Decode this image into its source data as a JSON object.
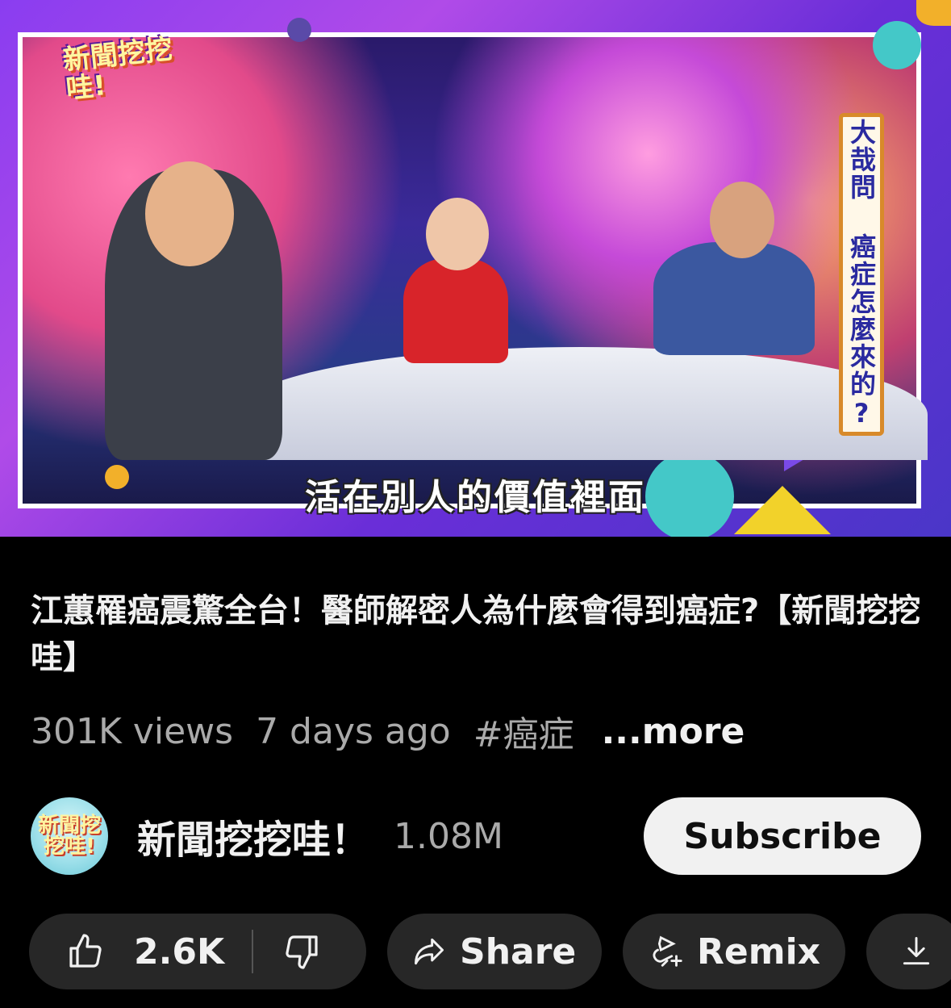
{
  "video": {
    "logo_text": "新聞挖挖哇!",
    "side_banner": "大哉問 癌症怎麼來的?",
    "subtitle": "活在別人的價值裡面"
  },
  "title": "江蕙罹癌震驚全台！醫師解密人為什麼會得到癌症?【新聞挖挖哇】",
  "meta": {
    "views": "301K views",
    "age": "7 days ago",
    "hashtag": "#癌症",
    "more": "...more"
  },
  "channel": {
    "avatar_text": "新聞挖挖哇!",
    "name": "新聞挖挖哇！",
    "subscribers": "1.08M",
    "subscribe_label": "Subscribe"
  },
  "actions": {
    "like_count": "2.6K",
    "share_label": "Share",
    "remix_label": "Remix"
  },
  "colors": {
    "background": "#000000",
    "pill": "#272727",
    "subscribe_bg": "#f1f1f1",
    "secondary_text": "#aaaaaa"
  },
  "icons": [
    "thumbs-up-icon",
    "thumbs-down-icon",
    "share-arrow-icon",
    "remix-icon",
    "download-icon"
  ]
}
